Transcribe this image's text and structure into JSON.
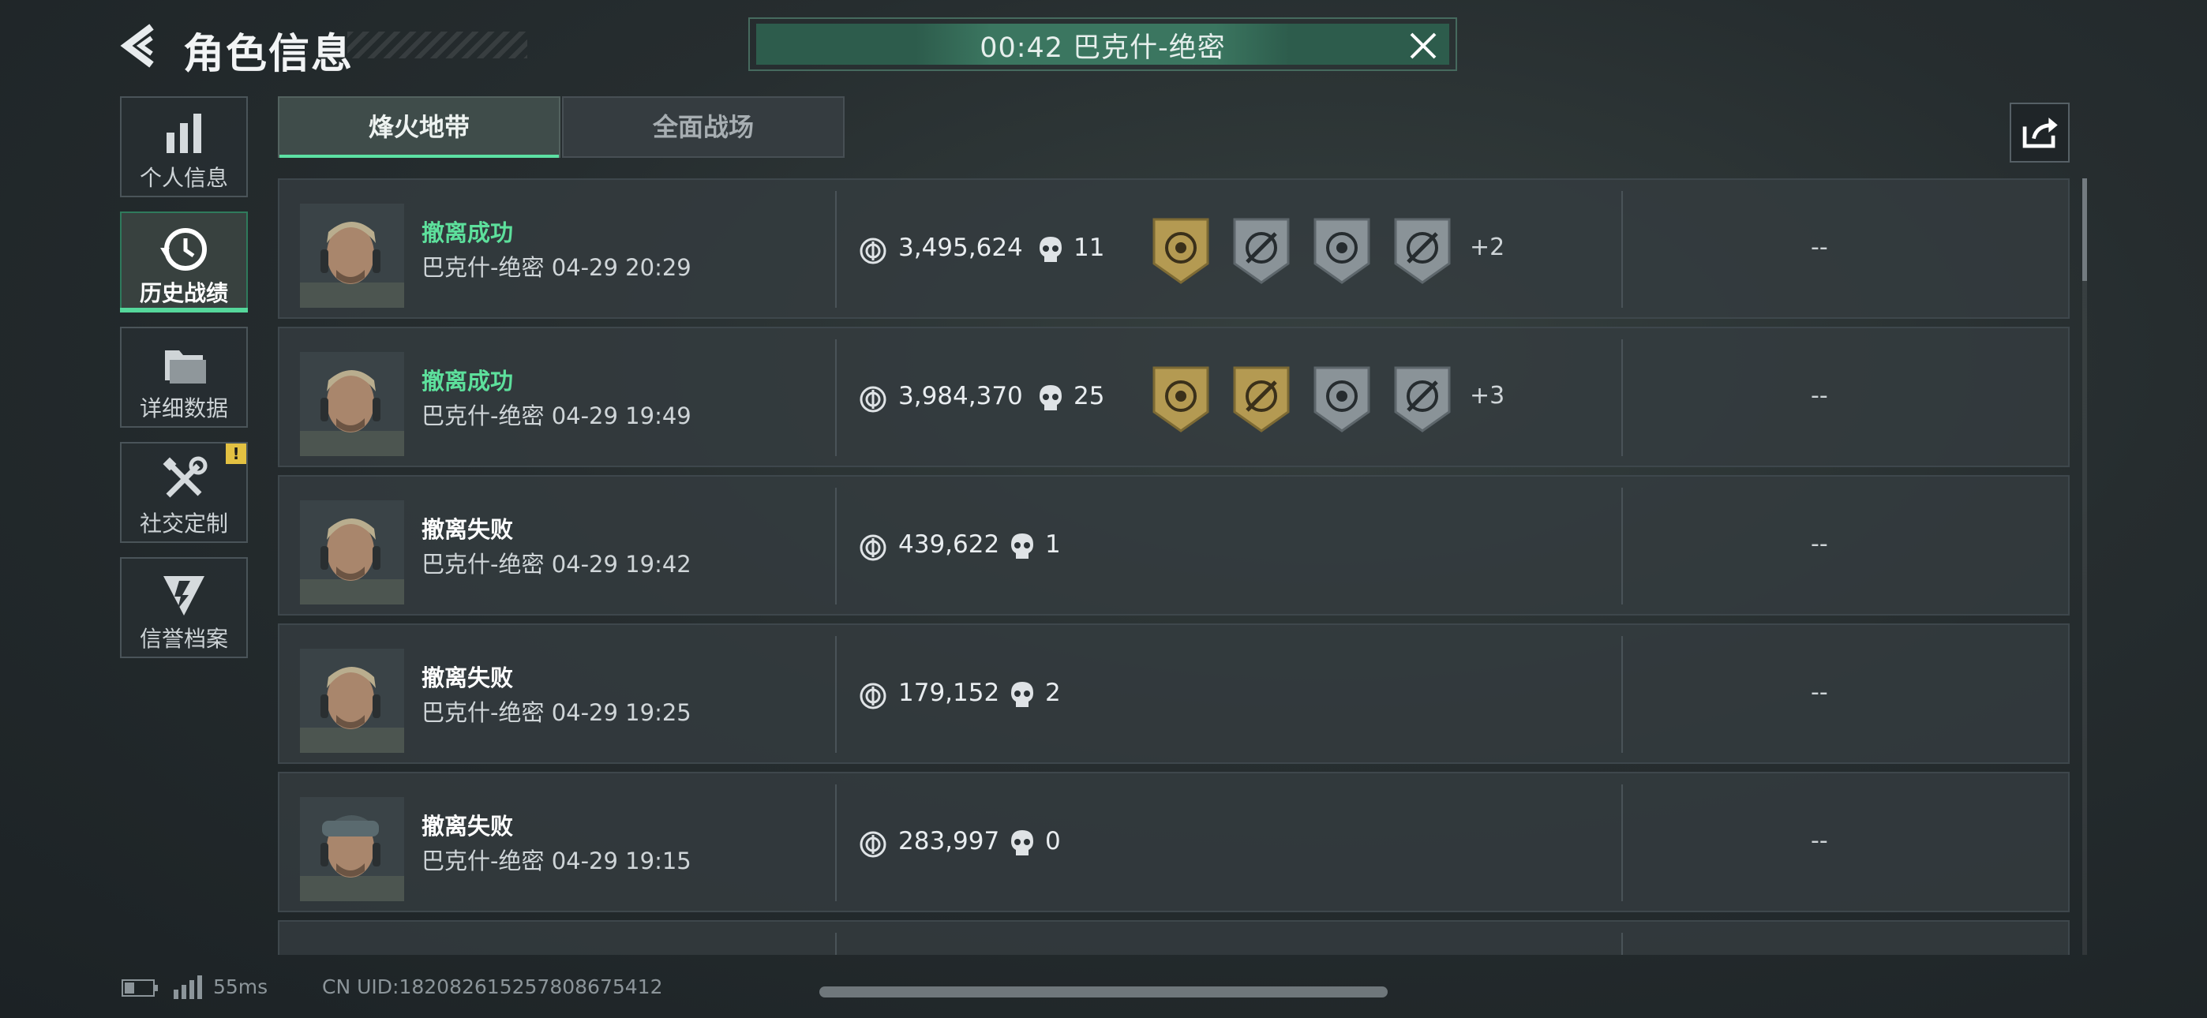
{
  "header": {
    "title": "角色信息",
    "back_icon": "back-arrow-icon"
  },
  "banner": {
    "text": "00:42 巴克什-绝密",
    "close_icon": "close-icon"
  },
  "sidebar": {
    "items": [
      {
        "label": "个人信息",
        "icon": "bar-chart-icon"
      },
      {
        "label": "历史战绩",
        "icon": "history-clock-icon",
        "active": true
      },
      {
        "label": "详细数据",
        "icon": "folder-stack-icon"
      },
      {
        "label": "社交定制",
        "icon": "tools-icon",
        "badge": "!"
      },
      {
        "label": "信誉档案",
        "icon": "shield-emblem-icon"
      }
    ]
  },
  "tabs": [
    {
      "label": "烽火地带",
      "active": true
    },
    {
      "label": "全面战场",
      "active": false
    }
  ],
  "share_icon": "share-icon",
  "records": [
    {
      "status": "撤离成功",
      "success": true,
      "map": "巴克什-绝密",
      "time": "04-29 20:29",
      "value": "3,495,624",
      "kills": "11",
      "medals": [
        "gold",
        "silver",
        "silver",
        "silver"
      ],
      "extra": "+2",
      "right": "--"
    },
    {
      "status": "撤离成功",
      "success": true,
      "map": "巴克什-绝密",
      "time": "04-29 19:49",
      "value": "3,984,370",
      "kills": "25",
      "medals": [
        "gold",
        "gold",
        "silver",
        "silver"
      ],
      "extra": "+3",
      "right": "--"
    },
    {
      "status": "撤离失败",
      "success": false,
      "map": "巴克什-绝密",
      "time": "04-29 19:42",
      "value": "439,622",
      "kills": "1",
      "medals": [],
      "extra": "",
      "right": "--"
    },
    {
      "status": "撤离失败",
      "success": false,
      "map": "巴克什-绝密",
      "time": "04-29 19:25",
      "value": "179,152",
      "kills": "2",
      "medals": [],
      "extra": "",
      "right": "--"
    },
    {
      "status": "撤离失败",
      "success": false,
      "map": "巴克什-绝密",
      "time": "04-29 19:15",
      "value": "283,997",
      "kills": "0",
      "medals": [],
      "extra": "",
      "right": "--"
    }
  ],
  "footer": {
    "ping": "55ms",
    "uid": "CN UID:182082615257808675412"
  },
  "colors": {
    "success": "#5de09c",
    "accent": "#55d79b",
    "medal_gold": "#b49a52",
    "medal_silver": "#8a9398",
    "badge": "#e3c142"
  }
}
